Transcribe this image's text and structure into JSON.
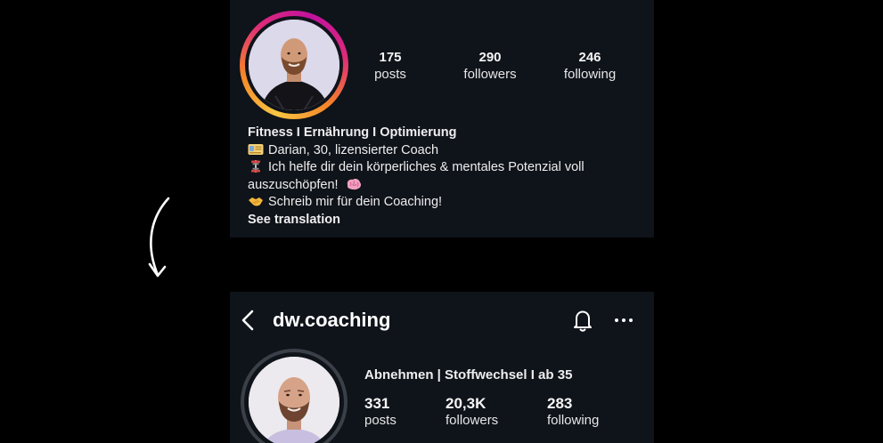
{
  "before": {
    "stats": [
      {
        "value": "175",
        "label": "posts"
      },
      {
        "value": "290",
        "label": "followers"
      },
      {
        "value": "246",
        "label": "following"
      }
    ],
    "bio": {
      "title": "Fitness I Ernährung I Optimierung",
      "lines": [
        {
          "icon": "id-card-emoji",
          "text": "Darian, 30, lizensierter Coach"
        },
        {
          "icon": "dumbbell-emoji",
          "text": "Ich helfe dir dein körperliches & mentales Potenzial voll"
        },
        {
          "icon": "",
          "text": "auszuschöpfen!"
        },
        {
          "icon": "handshake-emoji",
          "text": "Schreib mir für dein Coaching!"
        }
      ],
      "see_translation": "See translation"
    },
    "story_ring_colors": [
      "#f9c642",
      "#f58529",
      "#dd2a7b",
      "#c1129e"
    ]
  },
  "after": {
    "username": "dw.coaching",
    "tagline": "Abnehmen | Stoffwechsel I ab 35",
    "stats": [
      {
        "value": "331",
        "label": "posts"
      },
      {
        "value": "20,3K",
        "label": "followers"
      },
      {
        "value": "283",
        "label": "following"
      }
    ]
  },
  "colors": {
    "background": "#000000",
    "panel": "#0f131a",
    "text": "#f5f5f5"
  }
}
